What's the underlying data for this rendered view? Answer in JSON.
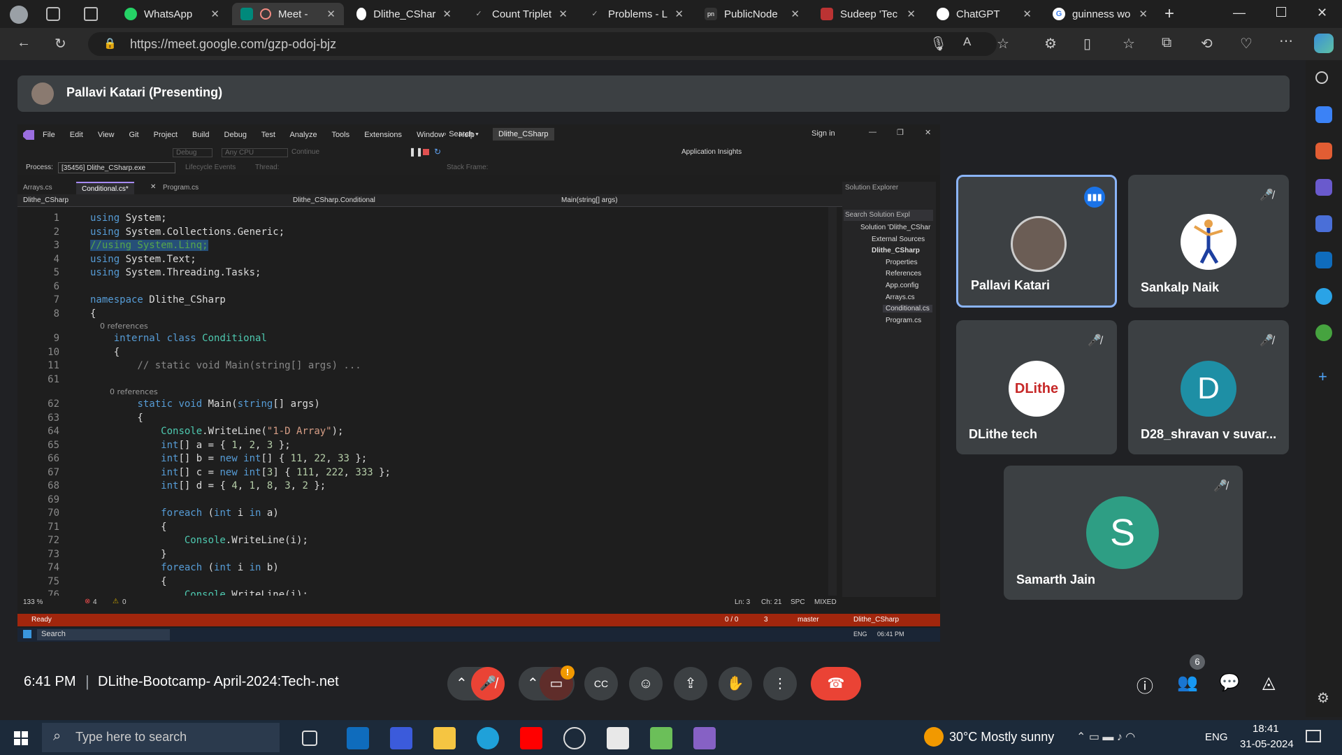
{
  "browser": {
    "tabs": [
      {
        "label": "WhatsApp",
        "icon": "whatsapp-icon"
      },
      {
        "label": "Meet - ",
        "icon": "meet-icon",
        "active": true
      },
      {
        "label": "Dlithe_CShar",
        "icon": "github-icon"
      },
      {
        "label": "Count Triplet",
        "icon": "leetcode-icon"
      },
      {
        "label": "Problems - L",
        "icon": "leetcode-icon"
      },
      {
        "label": "PublicNode",
        "icon": "publicnode-icon"
      },
      {
        "label": "Sudeep 'Tec",
        "icon": "page-icon"
      },
      {
        "label": "ChatGPT",
        "icon": "chatgpt-icon"
      },
      {
        "label": "guinness wo",
        "icon": "google-icon"
      }
    ],
    "url": "https://meet.google.com/gzp-odoj-bjz"
  },
  "presenting": {
    "text": "Pallavi Katari (Presenting)"
  },
  "vs": {
    "menu": [
      "File",
      "Edit",
      "View",
      "Git",
      "Project",
      "Build",
      "Debug",
      "Test",
      "Analyze",
      "Tools",
      "Extensions",
      "Window",
      "Help"
    ],
    "search": "Search",
    "solution_badge": "Dlithe_CSharp",
    "sign_in": "Sign in",
    "debug_config": "Debug",
    "platform": "Any CPU",
    "continue": "Continue",
    "app_insights": "Application Insights",
    "process_label": "Process:",
    "process_value": "[35456] Dlithe_CSharp.exe",
    "lifecycle": "Lifecycle Events",
    "thread": "Thread:",
    "stack_frame": "Stack Frame:",
    "doc_tabs": [
      "Arrays.cs",
      "Conditional.cs*",
      "Program.cs"
    ],
    "nav_project": "Dlithe_CSharp",
    "nav_class": "Dlithe_CSharp.Conditional",
    "nav_member": "Main(string[] args)",
    "code": [
      {
        "ln": "1",
        "text": "using System;"
      },
      {
        "ln": "2",
        "text": "using System.Collections.Generic;"
      },
      {
        "ln": "3",
        "text": "//using System.Linq;"
      },
      {
        "ln": "4",
        "text": "using System.Text;"
      },
      {
        "ln": "5",
        "text": "using System.Threading.Tasks;"
      },
      {
        "ln": "6",
        "text": ""
      },
      {
        "ln": "7",
        "text": "namespace Dlithe_CSharp"
      },
      {
        "ln": "8",
        "text": "{"
      },
      {
        "ln": "",
        "text": "    0 references"
      },
      {
        "ln": "9",
        "text": "    internal class Conditional"
      },
      {
        "ln": "10",
        "text": "    {"
      },
      {
        "ln": "11",
        "text": "        // static void Main(string[] args) ..."
      },
      {
        "ln": "61",
        "text": ""
      },
      {
        "ln": "",
        "text": "        0 references"
      },
      {
        "ln": "62",
        "text": "        static void Main(string[] args)"
      },
      {
        "ln": "63",
        "text": "        {"
      },
      {
        "ln": "64",
        "text": "            Console.WriteLine(\"1-D Array\");"
      },
      {
        "ln": "65",
        "text": "            int[] a = { 1, 2, 3 };"
      },
      {
        "ln": "66",
        "text": "            int[] b = new int[] { 11, 22, 33 };"
      },
      {
        "ln": "67",
        "text": "            int[] c = new int[3] { 111, 222, 333 };"
      },
      {
        "ln": "68",
        "text": "            int[] d = { 4, 1, 8, 3, 2 };"
      },
      {
        "ln": "69",
        "text": ""
      },
      {
        "ln": "70",
        "text": "            foreach (int i in a)"
      },
      {
        "ln": "71",
        "text": "            {"
      },
      {
        "ln": "72",
        "text": "                Console.WriteLine(i);"
      },
      {
        "ln": "73",
        "text": "            }"
      },
      {
        "ln": "74",
        "text": "            foreach (int i in b)"
      },
      {
        "ln": "75",
        "text": "            {"
      },
      {
        "ln": "76",
        "text": "                Console.WriteLine(i);"
      }
    ],
    "solution_explorer": {
      "title": "Solution Explorer",
      "search": "Search Solution Expl",
      "items": [
        "Solution 'Dlithe_CShar",
        "External Sources",
        "Dlithe_CSharp",
        "Properties",
        "References",
        "App.config",
        "Arrays.cs",
        "Conditional.cs",
        "Program.cs"
      ]
    },
    "status": {
      "zoom": "133 %",
      "errors": "4",
      "warnings": "0",
      "ln": "Ln: 3",
      "ch": "Ch: 21",
      "spc": "SPC",
      "mixed": "MIXED",
      "ready": "Ready",
      "changes": "0 / 0",
      "pencil": "3",
      "branch": "master",
      "repo": "Dlithe_CSharp"
    },
    "inner_taskbar": {
      "search": "Search",
      "lang": "ENG",
      "time": "06:41 PM"
    }
  },
  "participants": [
    {
      "name": "Pallavi Katari",
      "speaking": true
    },
    {
      "name": "Sankalp Naik"
    },
    {
      "name": "DLithe tech",
      "avatar_text": "DLithe"
    },
    {
      "name": "D28_shravan v suvar...",
      "initial": "D",
      "color": "#1e8fa5"
    },
    {
      "name": "Samarth Jain",
      "initial": "S",
      "color": "#2e9e84"
    }
  ],
  "meeting": {
    "time": "6:41 PM",
    "separator": "|",
    "title": "DLithe-Bootcamp- April-2024:Tech-.net",
    "people_count": "6",
    "camera_badge": "!"
  },
  "taskbar": {
    "search_placeholder": "Type here to search",
    "weather": "30°C  Mostly sunny",
    "lang": "ENG",
    "time": "18:41",
    "date": "31-05-2024"
  }
}
